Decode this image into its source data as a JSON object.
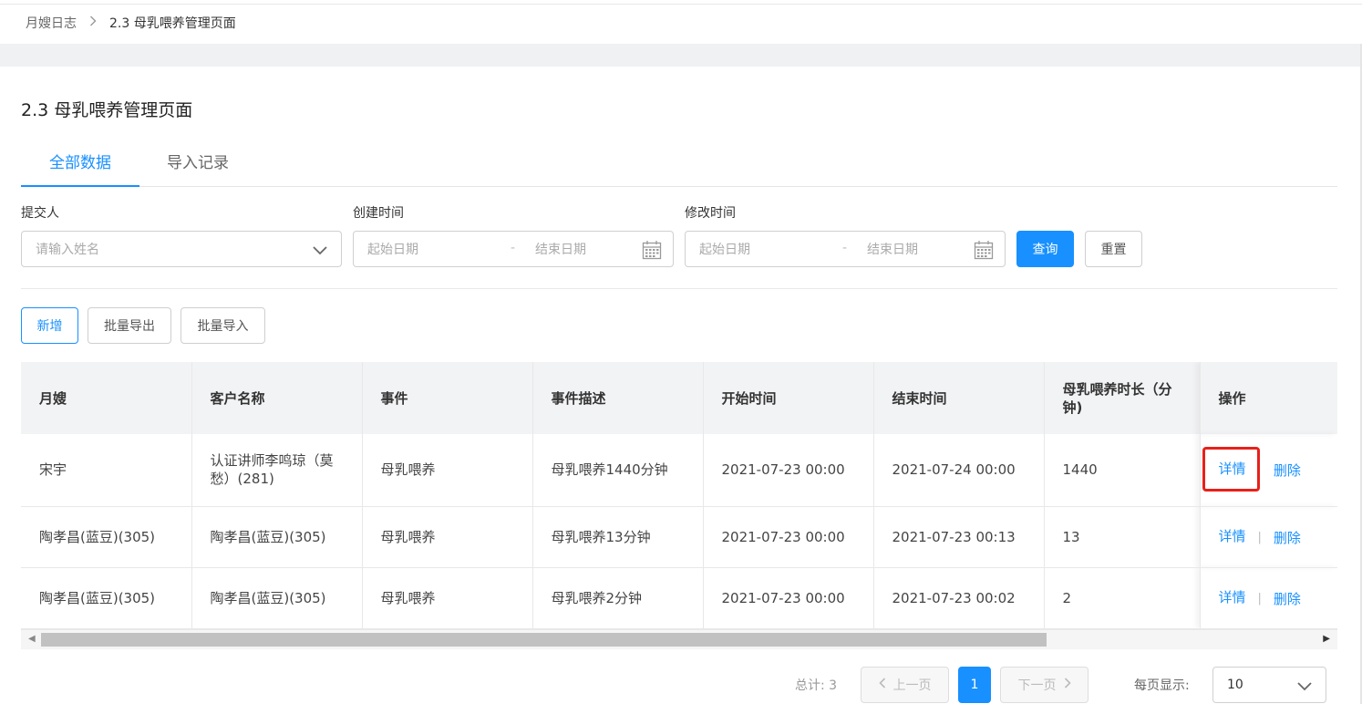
{
  "breadcrumb": {
    "root": "月嫂日志",
    "current": "2.3 母乳喂养管理页面"
  },
  "page": {
    "title": "2.3 母乳喂养管理页面"
  },
  "tabs": [
    {
      "label": "全部数据",
      "active": true
    },
    {
      "label": "导入记录",
      "active": false
    }
  ],
  "filters": {
    "submitter": {
      "label": "提交人",
      "placeholder": "请输入姓名"
    },
    "created": {
      "label": "创建时间",
      "start": "起始日期",
      "sep": "-",
      "end": "结束日期"
    },
    "modified": {
      "label": "修改时间",
      "start": "起始日期",
      "sep": "-",
      "end": "结束日期"
    },
    "query_label": "查询",
    "reset_label": "重置"
  },
  "toolbar": {
    "add": "新增",
    "export": "批量导出",
    "import": "批量导入"
  },
  "table": {
    "columns": [
      "月嫂",
      "客户名称",
      "事件",
      "事件描述",
      "开始时间",
      "结束时间",
      "母乳喂养时长（分钟)",
      "操作"
    ],
    "rows": [
      {
        "nanny": "宋宇",
        "customer": "认证讲师李鸣琼（莫愁）(281)",
        "event": "母乳喂养",
        "desc": "母乳喂养1440分钟",
        "start": "2021-07-23 00:00",
        "end": "2021-07-24 00:00",
        "duration": "1440"
      },
      {
        "nanny": "陶孝昌(蓝豆)(305)",
        "customer": "陶孝昌(蓝豆)(305)",
        "event": "母乳喂养",
        "desc": "母乳喂养13分钟",
        "start": "2021-07-23 00:00",
        "end": "2021-07-23 00:13",
        "duration": "13"
      },
      {
        "nanny": "陶孝昌(蓝豆)(305)",
        "customer": "陶孝昌(蓝豆)(305)",
        "event": "母乳喂养",
        "desc": "母乳喂养2分钟",
        "start": "2021-07-23 00:00",
        "end": "2021-07-23 00:02",
        "duration": "2"
      }
    ],
    "actions": {
      "detail": "详情",
      "sep": "|",
      "delete": "删除"
    },
    "highlight_color": "#e8201a"
  },
  "pagination": {
    "total_label": "总计: 3",
    "prev": "上一页",
    "current": "1",
    "next": "下一页",
    "per_page_label": "每页显示:",
    "per_page": "10"
  },
  "colors": {
    "primary": "#1890ff",
    "header_bg": "#f2f3f5"
  }
}
